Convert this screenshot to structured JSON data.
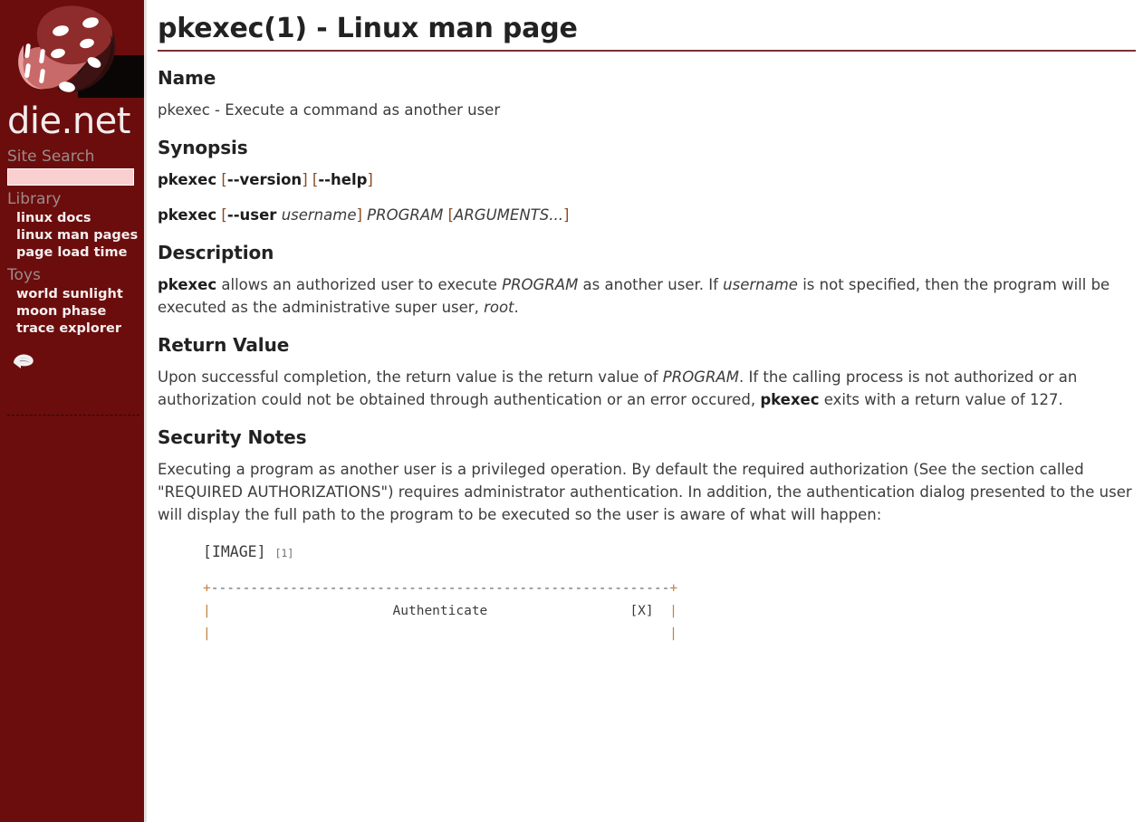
{
  "sidebar": {
    "brand": "die.net",
    "logo_alt": "dice-logo",
    "search": {
      "heading": "Site Search",
      "value": "",
      "placeholder": ""
    },
    "sections": [
      {
        "heading": "Library",
        "links": [
          "linux docs",
          "linux man pages",
          "page load time"
        ]
      },
      {
        "heading": "Toys",
        "links": [
          "world sunlight",
          "moon phase",
          "trace explorer"
        ]
      }
    ],
    "feed_icon": "rss-feed-icon"
  },
  "main": {
    "title": "pkexec(1) - Linux man page",
    "sections": [
      {
        "heading": "Name",
        "paragraphs": [
          "pkexec - Execute a command as another user"
        ]
      },
      {
        "heading": "Synopsis",
        "synopsis": [
          {
            "parts": [
              {
                "text": "pkexec",
                "style": "bold"
              },
              {
                "text": " ",
                "style": "plain"
              },
              {
                "text": "[",
                "style": "bracket"
              },
              {
                "text": "--version",
                "style": "bold"
              },
              {
                "text": "]",
                "style": "bracket"
              },
              {
                "text": " ",
                "style": "plain"
              },
              {
                "text": "[",
                "style": "bracket"
              },
              {
                "text": "--help",
                "style": "bold"
              },
              {
                "text": "]",
                "style": "bracket"
              }
            ]
          },
          {
            "parts": [
              {
                "text": "pkexec",
                "style": "bold"
              },
              {
                "text": " ",
                "style": "plain"
              },
              {
                "text": "[",
                "style": "bracket"
              },
              {
                "text": "--user",
                "style": "bold"
              },
              {
                "text": " ",
                "style": "plain"
              },
              {
                "text": "username",
                "style": "italic"
              },
              {
                "text": "]",
                "style": "bracket"
              },
              {
                "text": " ",
                "style": "plain"
              },
              {
                "text": "PROGRAM",
                "style": "italic"
              },
              {
                "text": " ",
                "style": "plain"
              },
              {
                "text": "[",
                "style": "bracket"
              },
              {
                "text": "ARGUMENTS...",
                "style": "italic"
              },
              {
                "text": "]",
                "style": "bracket"
              }
            ]
          }
        ]
      },
      {
        "heading": "Description",
        "rich": [
          {
            "text": "pkexec",
            "style": "bold"
          },
          {
            "text": " allows an authorized user to execute ",
            "style": "plain"
          },
          {
            "text": "PROGRAM",
            "style": "italic"
          },
          {
            "text": " as another user. If ",
            "style": "plain"
          },
          {
            "text": "username",
            "style": "italic"
          },
          {
            "text": " is not specified, then the program will be executed as the administrative super user, ",
            "style": "plain"
          },
          {
            "text": "root",
            "style": "italic"
          },
          {
            "text": ".",
            "style": "plain"
          }
        ]
      },
      {
        "heading": "Return Value",
        "rich": [
          {
            "text": "Upon successful completion, the return value is the return value of ",
            "style": "plain"
          },
          {
            "text": "PROGRAM",
            "style": "italic"
          },
          {
            "text": ". If the calling process is not authorized or an authorization could not be obtained through authentication or an error occured, ",
            "style": "plain"
          },
          {
            "text": "pkexec",
            "style": "bold"
          },
          {
            "text": " exits with a return value of 127.",
            "style": "plain"
          }
        ]
      },
      {
        "heading": "Security Notes",
        "rich": [
          {
            "text": "Executing a program as another user is a privileged operation. By default the required authorization (See the section called \"REQUIRED AUTHORIZATIONS\") requires administrator authentication. In addition, the authentication dialog presented to the user will display the full path to the program to be executed so the user is aware of what will happen:",
            "style": "plain"
          }
        ]
      }
    ],
    "image_placeholder": {
      "label": "[IMAGE]",
      "footnote": "[1]"
    },
    "ascii_box": {
      "top_border": "+----------------------------------------------------------+",
      "row_left": "|",
      "row_title": "Authenticate",
      "row_close": "[X]",
      "row_right": "|"
    }
  },
  "colors": {
    "sidebar_bg": "#6b0d0d",
    "sidebar_heading": "#9d8a8a",
    "sidebar_link": "#f5eeee",
    "title_rule": "#7a3030",
    "bracket": "#8a4b22",
    "search_bg": "#f9cfcf",
    "body_text": "#3c3c3c"
  }
}
